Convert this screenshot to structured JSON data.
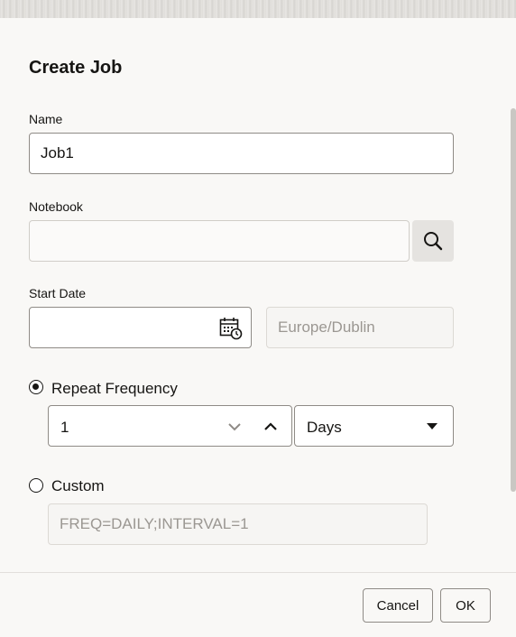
{
  "dialog": {
    "title": "Create Job"
  },
  "fields": {
    "name": {
      "label": "Name",
      "value": "Job1"
    },
    "notebook": {
      "label": "Notebook",
      "value": "",
      "search_icon": "search-icon"
    },
    "start_date": {
      "label": "Start Date",
      "value": "",
      "calendar_icon": "calendar-clock-icon",
      "timezone": "Europe/Dublin"
    }
  },
  "repeat": {
    "frequency_label": "Repeat Frequency",
    "frequency_selected": true,
    "interval_value": "1",
    "unit_value": "Days",
    "custom_label": "Custom",
    "custom_selected": false,
    "custom_placeholder": "FREQ=DAILY;INTERVAL=1"
  },
  "footer": {
    "cancel_label": "Cancel",
    "ok_label": "OK"
  },
  "colors": {
    "text": "#161513",
    "border": "#8f8b86",
    "background": "#f9f8f6",
    "muted": "#9b9792"
  }
}
